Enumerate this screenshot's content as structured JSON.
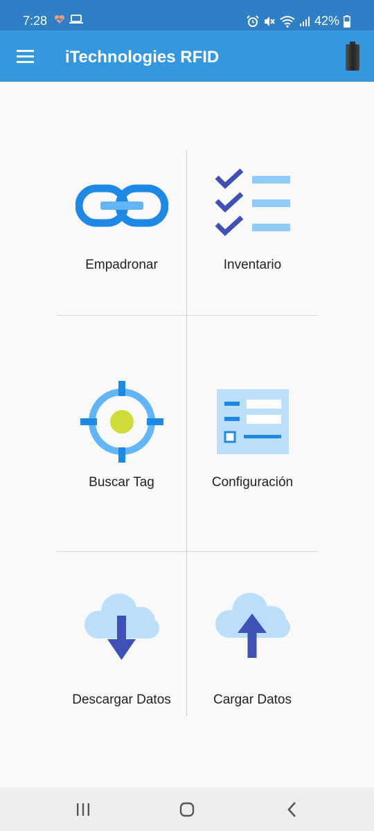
{
  "status_bar": {
    "time": "7:28",
    "left_icons": [
      "heart-icon",
      "laptop-icon"
    ],
    "right_icons": [
      "alarm-icon",
      "mute-icon",
      "wifi-icon",
      "signal-icon",
      "battery-icon"
    ],
    "battery_percent": "42%"
  },
  "app_bar": {
    "title": "iTechnologies RFID",
    "menu_icon": "hamburger-menu-icon",
    "battery_indicator_icon": "device-battery-icon"
  },
  "menu": {
    "items": [
      {
        "label": "Empadronar",
        "icon": "chain-link-icon"
      },
      {
        "label": "Inventario",
        "icon": "checklist-icon"
      },
      {
        "label": "Buscar Tag",
        "icon": "crosshair-target-icon"
      },
      {
        "label": "Configuración",
        "icon": "settings-form-icon"
      },
      {
        "label": "Descargar Datos",
        "icon": "cloud-download-icon"
      },
      {
        "label": "Cargar Datos",
        "icon": "cloud-upload-icon"
      }
    ]
  },
  "nav_bar": {
    "items": [
      "recent-apps-icon",
      "home-icon",
      "back-icon"
    ]
  },
  "colors": {
    "status_bar": "#2f7fc7",
    "app_bar": "#3597de",
    "icon_blue": "#1e88e5",
    "icon_light_blue": "#90caf9",
    "icon_indigo": "#3f51b5",
    "target_dot": "#cddc39",
    "background": "#f9f9f9"
  }
}
